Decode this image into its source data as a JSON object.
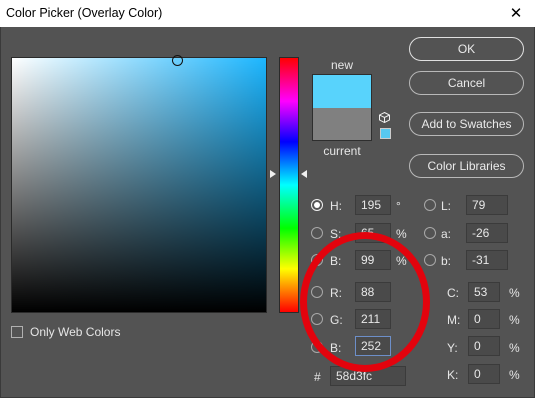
{
  "window": {
    "title": "Color Picker (Overlay Color)",
    "close_glyph": "✕"
  },
  "swatches": {
    "new_label": "new",
    "current_label": "current",
    "new_color": "#58d3fc",
    "current_color": "#808080"
  },
  "buttons": {
    "ok": "OK",
    "cancel": "Cancel",
    "add_to_swatches": "Add to Swatches",
    "color_libraries": "Color Libraries"
  },
  "hsb": {
    "h": {
      "label": "H:",
      "value": "195",
      "unit": "°"
    },
    "s": {
      "label": "S:",
      "value": "65",
      "unit": "%"
    },
    "b": {
      "label": "B:",
      "value": "99",
      "unit": "%"
    }
  },
  "lab": {
    "l": {
      "label": "L:",
      "value": "79"
    },
    "a": {
      "label": "a:",
      "value": "-26"
    },
    "b": {
      "label": "b:",
      "value": "-31"
    }
  },
  "rgb": {
    "r": {
      "label": "R:",
      "value": "88"
    },
    "g": {
      "label": "G:",
      "value": "211"
    },
    "b": {
      "label": "B:",
      "value": "252"
    }
  },
  "cmyk": {
    "c": {
      "label": "C:",
      "value": "53",
      "unit": "%"
    },
    "m": {
      "label": "M:",
      "value": "0",
      "unit": "%"
    },
    "y": {
      "label": "Y:",
      "value": "0",
      "unit": "%"
    },
    "k": {
      "label": "K:",
      "value": "0",
      "unit": "%"
    }
  },
  "hex": {
    "label": "#",
    "value": "58d3fc"
  },
  "web_colors_label": "Only Web Colors",
  "annotation_color": "#e3030d"
}
